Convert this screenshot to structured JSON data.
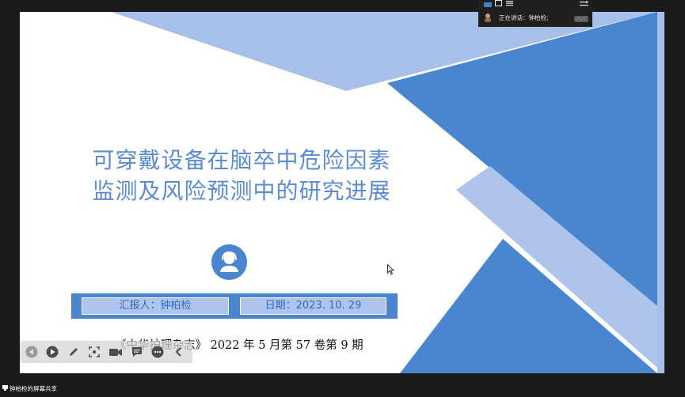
{
  "slide": {
    "title_line_1": "可穿戴设备在脑卒中危险因素",
    "title_line_2": "监测及风险预测中的研究进展",
    "reporter": "汇报人：钟柏检",
    "date": "日期：2023. 10. 29",
    "citation": "《中华护理杂志》 2022 年 5 月第 57 卷第 9 期",
    "colors": {
      "primary_blue": "#4a86d0",
      "light_blue": "#a7c0ea",
      "title_blue": "#5b8bd3"
    }
  },
  "speaker_panel": {
    "speaking_text": "正在讲话：钟柏检;",
    "icons": [
      "layout-icon",
      "window-icon",
      "list-icon",
      "collapse-icon",
      "avatar-icon",
      "audio-icon"
    ]
  },
  "toolbar": {
    "icons": [
      "back-icon",
      "play-icon",
      "pen-icon",
      "focus-icon",
      "camera-icon",
      "comment-icon",
      "more-icon",
      "collapse-arrow-icon"
    ]
  },
  "footer": {
    "share_label": "钟柏检的屏幕共享"
  }
}
